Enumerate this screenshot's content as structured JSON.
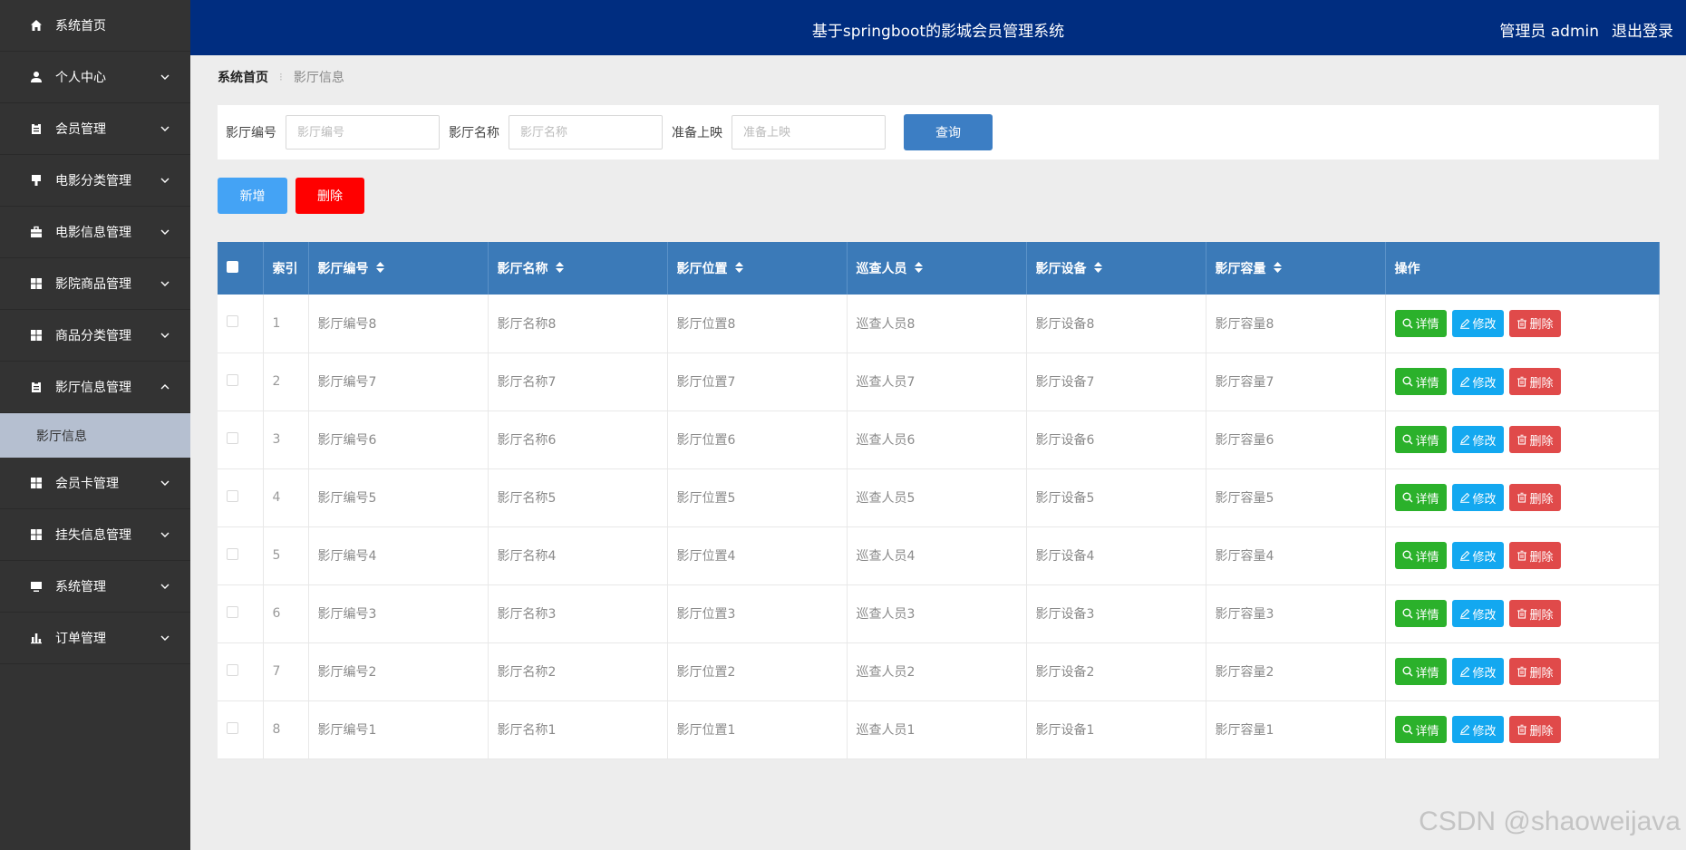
{
  "header": {
    "title": "基于springboot的影城会员管理系统",
    "user": "管理员 admin",
    "logout": "退出登录"
  },
  "sidebar": {
    "items": [
      {
        "label": "系统首页",
        "icon": "home-icon",
        "has_chevron": false
      },
      {
        "label": "个人中心",
        "icon": "user-icon",
        "has_chevron": true,
        "chevron": "down"
      },
      {
        "label": "会员管理",
        "icon": "clipboard-icon",
        "has_chevron": true,
        "chevron": "down"
      },
      {
        "label": "电影分类管理",
        "icon": "brush-icon",
        "has_chevron": true,
        "chevron": "down"
      },
      {
        "label": "电影信息管理",
        "icon": "briefcase-icon",
        "has_chevron": true,
        "chevron": "down"
      },
      {
        "label": "影院商品管理",
        "icon": "grid-icon",
        "has_chevron": true,
        "chevron": "down"
      },
      {
        "label": "商品分类管理",
        "icon": "grid-icon",
        "has_chevron": true,
        "chevron": "down"
      },
      {
        "label": "影厅信息管理",
        "icon": "clipboard-icon",
        "has_chevron": true,
        "chevron": "up"
      }
    ],
    "sub_item": "影厅信息",
    "items_after": [
      {
        "label": "会员卡管理",
        "icon": "grid-icon",
        "has_chevron": true,
        "chevron": "down"
      },
      {
        "label": "挂失信息管理",
        "icon": "grid-icon",
        "has_chevron": true,
        "chevron": "down"
      },
      {
        "label": "系统管理",
        "icon": "monitor-icon",
        "has_chevron": true,
        "chevron": "down"
      },
      {
        "label": "订单管理",
        "icon": "bar-chart-icon",
        "has_chevron": true,
        "chevron": "down"
      }
    ]
  },
  "breadcrumb": {
    "home": "系统首页",
    "separator": "⁝",
    "current": "影厅信息"
  },
  "search": {
    "fields": [
      {
        "label": "影厅编号",
        "placeholder": "影厅编号",
        "value": ""
      },
      {
        "label": "影厅名称",
        "placeholder": "影厅名称",
        "value": ""
      },
      {
        "label": "准备上映",
        "placeholder": "准备上映",
        "value": ""
      }
    ],
    "query_label": "查询"
  },
  "actions": {
    "add_label": "新增",
    "delete_label": "删除"
  },
  "table": {
    "columns": [
      "索引",
      "影厅编号",
      "影厅名称",
      "影厅位置",
      "巡查人员",
      "影厅设备",
      "影厅容量",
      "操作"
    ],
    "rows": [
      [
        "1",
        "影厅编号8",
        "影厅名称8",
        "影厅位置8",
        "巡查人员8",
        "影厅设备8",
        "影厅容量8"
      ],
      [
        "2",
        "影厅编号7",
        "影厅名称7",
        "影厅位置7",
        "巡查人员7",
        "影厅设备7",
        "影厅容量7"
      ],
      [
        "3",
        "影厅编号6",
        "影厅名称6",
        "影厅位置6",
        "巡查人员6",
        "影厅设备6",
        "影厅容量6"
      ],
      [
        "4",
        "影厅编号5",
        "影厅名称5",
        "影厅位置5",
        "巡查人员5",
        "影厅设备5",
        "影厅容量5"
      ],
      [
        "5",
        "影厅编号4",
        "影厅名称4",
        "影厅位置4",
        "巡查人员4",
        "影厅设备4",
        "影厅容量4"
      ],
      [
        "6",
        "影厅编号3",
        "影厅名称3",
        "影厅位置3",
        "巡查人员3",
        "影厅设备3",
        "影厅容量3"
      ],
      [
        "7",
        "影厅编号2",
        "影厅名称2",
        "影厅位置2",
        "巡查人员2",
        "影厅设备2",
        "影厅容量2"
      ],
      [
        "8",
        "影厅编号1",
        "影厅名称1",
        "影厅位置1",
        "巡查人员1",
        "影厅设备1",
        "影厅容量1"
      ]
    ],
    "op_labels": {
      "detail": "详情",
      "edit": "修改",
      "delete": "删除"
    }
  },
  "watermark": "CSDN @shaoweijava",
  "colors": {
    "header_bg": "#002d80",
    "sidebar_bg": "#333333",
    "table_header": "#3b7ab8",
    "query_button": "#3c7ec4",
    "add_button": "#44a3f5",
    "delete_button": "#ff0000",
    "op_detail": "#2bb12b",
    "op_edit": "#13a8f0",
    "op_delete": "#e04a4a"
  }
}
